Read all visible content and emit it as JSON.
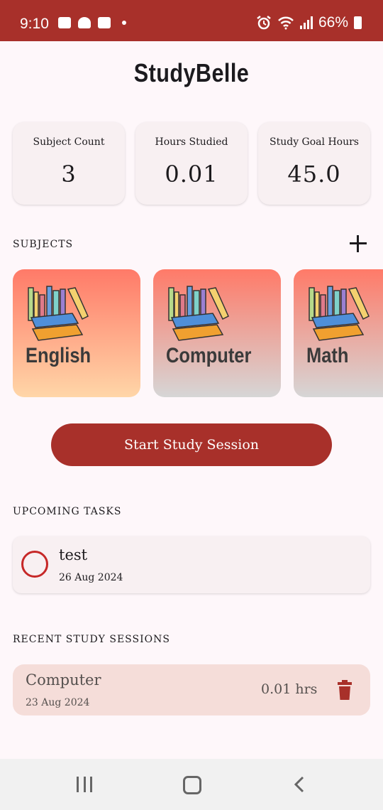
{
  "status_bar": {
    "time": "9:10",
    "battery": "66%",
    "icons": [
      "gallery-icon",
      "snapchat-icon",
      "notification-icon",
      "dot-icon",
      "alarm-icon",
      "wifi-icon",
      "signal-icon",
      "battery-icon"
    ]
  },
  "app": {
    "title": "StudyBelle"
  },
  "stats": [
    {
      "label": "Subject Count",
      "value": "3"
    },
    {
      "label": "Hours Studied",
      "value": "0.01"
    },
    {
      "label": "Study Goal Hours",
      "value": "45.0"
    }
  ],
  "subjects_section": {
    "header": "SUBJECTS",
    "add_icon": "plus-icon"
  },
  "subjects": [
    {
      "name": "English",
      "gradient": [
        "#ff7a68",
        "#ffd6a8"
      ]
    },
    {
      "name": "Computer",
      "gradient": [
        "#ff7a68",
        "#d6d6d6"
      ]
    },
    {
      "name": "Math",
      "gradient": [
        "#ff7a68",
        "#d6d6d6"
      ]
    }
  ],
  "start_button": {
    "label": "Start Study Session"
  },
  "tasks_section": {
    "header": "UPCOMING TASKS"
  },
  "tasks": [
    {
      "name": "test",
      "date": "26 Aug 2024"
    }
  ],
  "sessions_section": {
    "header": "RECENT STUDY SESSIONS"
  },
  "sessions": [
    {
      "subject": "Computer",
      "date": "23 Aug 2024",
      "hours": "0.01 hrs"
    }
  ],
  "colors": {
    "primary": "#a8302a",
    "background": "#fef7fa",
    "card": "#f8f0f2",
    "session_card": "#f5ddd9",
    "task_circle": "#c62828"
  }
}
